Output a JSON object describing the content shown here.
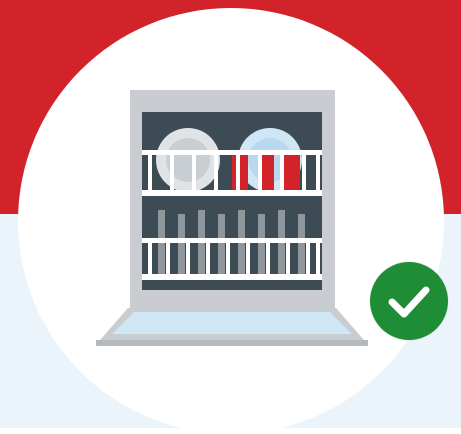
{
  "illustration": {
    "subject": "dishwasher-icon",
    "status_icon": "checkmark-icon"
  },
  "colors": {
    "brand_red": "#d2232a",
    "background_light": "#eaf4fa",
    "circle": "#ffffff",
    "dishwasher_frame": "#c9ccd0",
    "dishwasher_interior": "#3d4b55",
    "rack_white": "#ffffff",
    "door_blue": "#cfe6f5",
    "check_green": "#1f8d35"
  }
}
